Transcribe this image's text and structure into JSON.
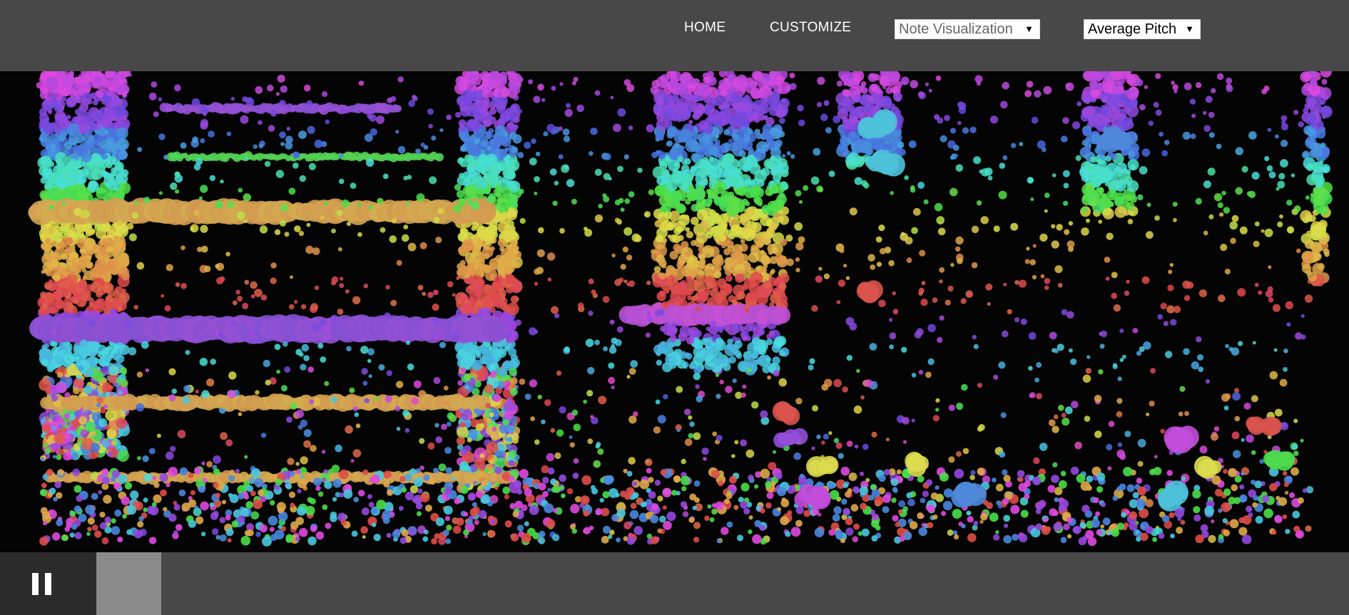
{
  "nav": {
    "home": "HOME",
    "customize": "CUSTOMIZE",
    "visualization_select": {
      "selected": "Note Visualization",
      "arrow": "▼"
    },
    "metric_select": {
      "selected": "Average Pitch",
      "arrow": "▼"
    }
  },
  "visualization": {
    "description": "note-dot-visualization",
    "background": "#040404",
    "palette": [
      "#d84a50",
      "#d9a040",
      "#c8c840",
      "#58c848",
      "#30c0a0",
      "#3a80d8",
      "#9050d0",
      "#c860c8"
    ]
  },
  "playback": {
    "state": "playing",
    "control_icon": "pause-icon",
    "progress_fraction": 0.052
  },
  "colors": {
    "topbar": "#484848",
    "bottombar": "#484848",
    "pause_bg": "#2b2b2b",
    "progress_fill": "#8a8a8a"
  }
}
